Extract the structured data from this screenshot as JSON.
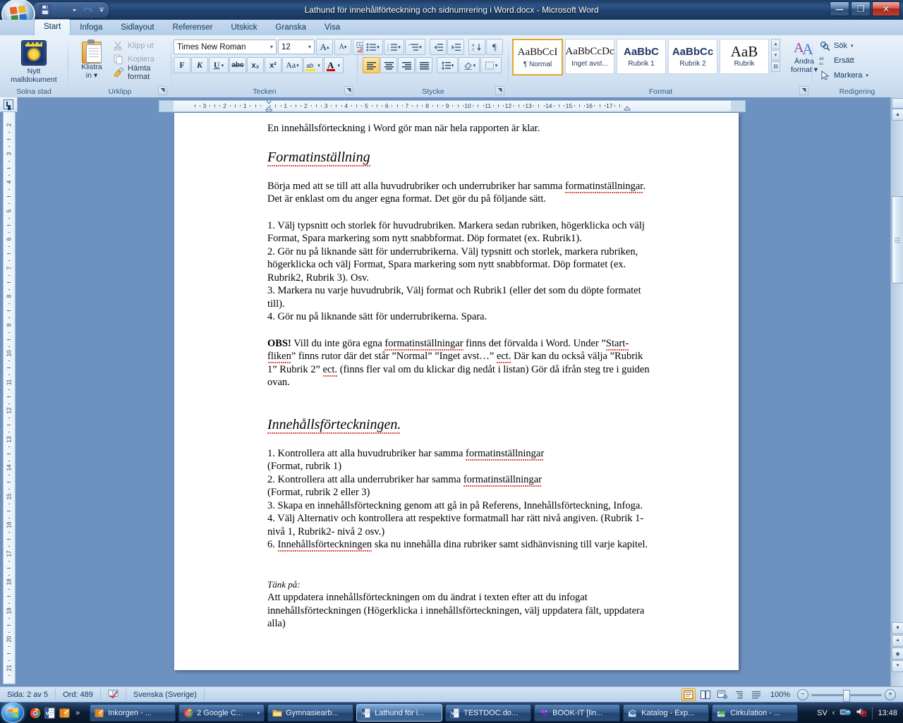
{
  "window": {
    "title": "Lathund för innehållförteckning och sidnumrering i Word.docx - Microsoft Word",
    "minimize_label": "—",
    "maximize_label": "❐",
    "close_label": "✕"
  },
  "quick_access": {
    "items": [
      {
        "name": "save-icon",
        "label": "Spara"
      },
      {
        "name": "undo-icon",
        "label": "Ångra"
      },
      {
        "name": "undo-dropdown-icon",
        "label": "Ångra-lista"
      },
      {
        "name": "redo-icon",
        "label": "Gör om"
      },
      {
        "name": "customize-qat-icon",
        "label": "Anpassa verktygsfältet Snabbåtkomst"
      }
    ]
  },
  "ribbon": {
    "tabs": [
      {
        "label": "Start",
        "active": true
      },
      {
        "label": "Infoga",
        "active": false
      },
      {
        "label": "Sidlayout",
        "active": false
      },
      {
        "label": "Referenser",
        "active": false
      },
      {
        "label": "Utskick",
        "active": false
      },
      {
        "label": "Granska",
        "active": false
      },
      {
        "label": "Visa",
        "active": false
      }
    ],
    "groups": {
      "solna": {
        "label": "Solna stad",
        "button_line1": "Nytt",
        "button_line2": "malldokument"
      },
      "clipboard": {
        "label": "Urklipp",
        "paste_line1": "Klistra",
        "paste_line2": "in",
        "cut": "Klipp ut",
        "copy": "Kopiera",
        "format_painter": "Hämta format",
        "dialog_launcher": "◥"
      },
      "font": {
        "label": "Tecken",
        "font_name": "Times New Roman",
        "font_size": "12",
        "grow_font": "A",
        "shrink_font": "A",
        "clear_formatting": "Aa",
        "bold": "F",
        "italic": "K",
        "underline": "U",
        "strikethrough": "abc",
        "subscript": "x₂",
        "superscript": "x²",
        "change_case": "Aa",
        "highlight": "ab",
        "font_color": "A",
        "dialog_launcher": "◥"
      },
      "paragraph": {
        "label": "Stycke",
        "bullets": "•≡",
        "numbering": "1≡",
        "multilevel": "≡",
        "decrease_indent": "◄≡",
        "increase_indent": "≡►",
        "sort": "A↓",
        "show_marks": "¶",
        "align_left": "≡",
        "align_center": "≡",
        "align_right": "≡",
        "justify": "≡",
        "line_spacing": "↕≡",
        "shading": "▲",
        "borders": "▦",
        "dialog_launcher": "◥"
      },
      "styles": {
        "label": "Format",
        "cards": [
          {
            "sample": "AaBbCcI",
            "name": "¶ Normal",
            "selected": true
          },
          {
            "sample": "AaBbCcDc",
            "name": "Inget avst...",
            "selected": false
          },
          {
            "sample": "AaBbC",
            "name": "Rubrik 1",
            "selected": false
          },
          {
            "sample": "AaBbCc",
            "name": "Rubrik 2",
            "selected": false
          },
          {
            "sample": "AaB",
            "name": "Rubrik",
            "selected": false
          }
        ],
        "change_styles_line1": "Ändra",
        "change_styles_line2": "format",
        "dialog_launcher": "◥"
      },
      "editing": {
        "label": "Redigering",
        "find": "Sök",
        "replace": "Ersätt",
        "select": "Markera"
      }
    }
  },
  "ruler": {
    "horizontal_numbers": [
      "3",
      "2",
      "1",
      "1",
      "2",
      "3",
      "4",
      "5",
      "6",
      "7",
      "8",
      "9",
      "10",
      "11",
      "12",
      "13",
      "14",
      "15",
      "16",
      "17"
    ],
    "vertical_numbers": [
      "2",
      "3",
      "4",
      "5",
      "6",
      "7",
      "8",
      "9",
      "10",
      "11",
      "12",
      "13",
      "14",
      "15",
      "16",
      "17",
      "18",
      "19",
      "20",
      "21"
    ]
  },
  "document": {
    "blocks": [
      {
        "type": "p",
        "text": "En innehållsförteckning i Word gör man när hela rapporten är klar."
      },
      {
        "type": "gap"
      },
      {
        "type": "h1",
        "text": "Formatinställning"
      },
      {
        "type": "gap"
      },
      {
        "type": "p",
        "text": "Börja med att se till att alla huvudrubriker och underrubriker har samma formatinställningar. Det är enklast om du anger egna format. Det gör du på följande sätt."
      },
      {
        "type": "gap"
      },
      {
        "type": "p",
        "text": "1. Välj typsnitt och storlek för huvudrubriken. Markera sedan rubriken, högerklicka och välj Format, Spara markering som nytt snabbformat. Döp formatet (ex. Rubrik1)."
      },
      {
        "type": "p",
        "text": "2. Gör nu på liknande sätt för underrubrikerna. Välj typsnitt och storlek, markera rubriken, högerklicka och välj Format, Spara markering som nytt snabbformat. Döp formatet (ex. Rubrik2, Rubrik 3). Osv."
      },
      {
        "type": "p",
        "text": "3. Markera nu varje huvudrubrik, Välj format och Rubrik1 (eller det som du döpte formatet till)."
      },
      {
        "type": "p",
        "text": "4. Gör nu på liknande sätt för underrubrikerna. Spara."
      },
      {
        "type": "gap"
      },
      {
        "type": "p_obs",
        "bold": "OBS!",
        "text": " Vill du inte göra egna formatinställningar finns det förvalda i Word. Under ”Start-fliken” finns rutor där det står ”Normal” ”Inget avst…” ect. Där kan du också välja ”Rubrik 1” Rubrik 2” ect. (finns fler val om du klickar dig nedåt i listan) Gör då ifrån steg tre i guiden ovan."
      },
      {
        "type": "gap2"
      },
      {
        "type": "h1",
        "text": "Innehållsförteckningen."
      },
      {
        "type": "gap"
      },
      {
        "type": "p",
        "text": "1. Kontrollera att alla huvudrubriker har samma formatinställningar"
      },
      {
        "type": "p",
        "text": "(Format, rubrik 1)"
      },
      {
        "type": "p",
        "text": "2. Kontrollera att alla underrubriker har samma formatinställningar"
      },
      {
        "type": "p",
        "text": "(Format, rubrik 2 eller 3)"
      },
      {
        "type": "p",
        "text": "3. Skapa en innehållsförteckning genom att gå in på Referens, Innehållsförteckning, Infoga."
      },
      {
        "type": "p",
        "text": "4. Välj Alternativ och kontrollera att respektive formatmall har rätt nivå angiven. (Rubrik 1- nivå 1, Rubrik2- nivå 2 osv.)"
      },
      {
        "type": "p",
        "text": "6. Innehållsförteckningen ska nu innehålla dina rubriker samt sidhänvisning till varje kapitel."
      },
      {
        "type": "gap2"
      },
      {
        "type": "it",
        "text": "Tänk på:"
      },
      {
        "type": "p",
        "text": "Att uppdatera innehållsförteckningen om du ändrat i texten efter att du infogat innehållsförteckningen (Högerklicka i innehållsförteckningen, välj uppdatera fält, uppdatera alla)"
      }
    ]
  },
  "status_bar": {
    "page": "Sida: 2 av 5",
    "words": "Ord: 489",
    "language": "Svenska (Sverige)",
    "proofing_icon": "spelling-check-icon",
    "views": [
      {
        "name": "print-layout-view",
        "glyph": "▤",
        "active": true
      },
      {
        "name": "full-screen-reading-view",
        "glyph": "▥",
        "active": false
      },
      {
        "name": "web-layout-view",
        "glyph": "▣",
        "active": false
      },
      {
        "name": "outline-view",
        "glyph": "▤",
        "active": false
      },
      {
        "name": "draft-view",
        "glyph": "▤",
        "active": false
      }
    ],
    "zoom": "100%",
    "zoom_out": "−",
    "zoom_in": "+"
  },
  "taskbar": {
    "start_label": "Start",
    "quick_launch": [
      {
        "name": "chrome-icon",
        "label": "Google Chrome"
      },
      {
        "name": "word-icon",
        "label": "Microsoft Word"
      },
      {
        "name": "outlook-icon",
        "label": "Microsoft Outlook"
      }
    ],
    "overflow": "»",
    "tasks": [
      {
        "label": "Inkorgen - ...",
        "icon": "outlook-icon",
        "active": false,
        "dropdown": false
      },
      {
        "label": "2 Google C...",
        "icon": "chrome-icon",
        "active": false,
        "dropdown": true
      },
      {
        "label": "Gymnasiearb...",
        "icon": "folder-icon",
        "active": false,
        "dropdown": false
      },
      {
        "label": "Lathund för i...",
        "icon": "word-icon",
        "active": true,
        "dropdown": false
      },
      {
        "label": "TESTDOC.do...",
        "icon": "word-icon",
        "active": false,
        "dropdown": false
      },
      {
        "label": "BOOK-IT [lin...",
        "icon": "bookit-icon",
        "active": false,
        "dropdown": false
      },
      {
        "label": "Katalog - Exp...",
        "icon": "katalog-icon",
        "active": false,
        "dropdown": false
      },
      {
        "label": "Cirkulation - ...",
        "icon": "cirkulation-icon",
        "active": false,
        "dropdown": false
      }
    ],
    "tray": {
      "language": "SV",
      "show_hidden": "‹",
      "network_icon": "network-icon",
      "volume_icon": "volume-muted-icon",
      "clock": "13:48"
    }
  },
  "colors": {
    "title_bar": "#1f4472",
    "ribbon": "#dce9f6",
    "accent_orange": "#e0a82e",
    "desktop": "#6e92c0",
    "page": "#ffffff",
    "spell_error": "#d11111"
  }
}
